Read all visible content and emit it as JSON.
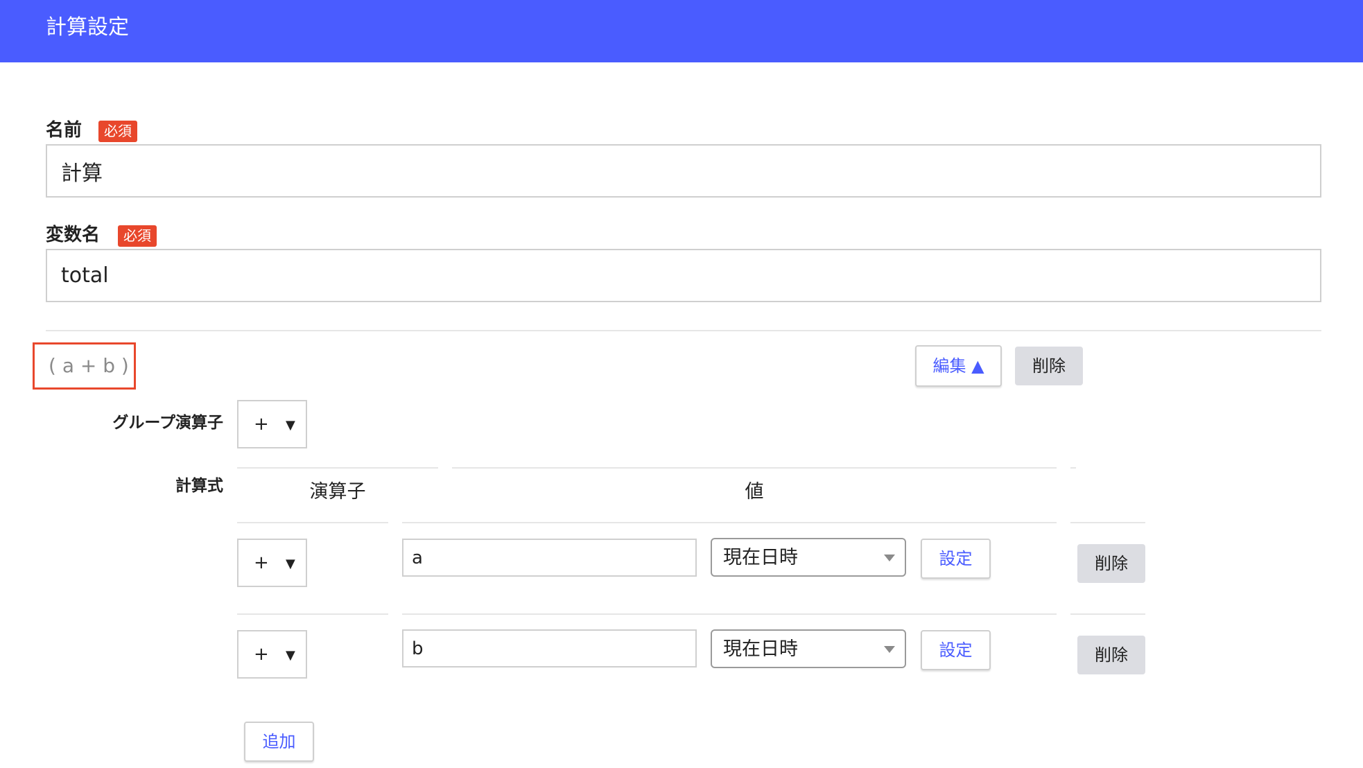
{
  "header": {
    "title": "計算設定"
  },
  "form": {
    "name": {
      "label": "名前",
      "badge": "必須",
      "value": "計算"
    },
    "variable": {
      "label": "変数名",
      "badge": "必須",
      "value": "total"
    }
  },
  "group": {
    "expression": "( a + b )",
    "edit_label": "編集 ▲",
    "delete_label": "削除",
    "group_operator_label": "グループ演算子",
    "group_operator_value": "+",
    "formula_label": "計算式",
    "columns": {
      "operator": "演算子",
      "value": "値"
    },
    "rows": [
      {
        "operator": "+",
        "value": "a",
        "type": "現在日時",
        "set_label": "設定",
        "delete_label": "削除"
      },
      {
        "operator": "+",
        "value": "b",
        "type": "現在日時",
        "set_label": "設定",
        "delete_label": "削除"
      }
    ],
    "add_label": "追加"
  },
  "icons": {
    "caret": "▼",
    "dropdown_arrow": "dropdown-arrow-icon"
  },
  "colors": {
    "header": "#4a5cff",
    "badge": "#e8472c",
    "accent": "#4a5cff"
  }
}
